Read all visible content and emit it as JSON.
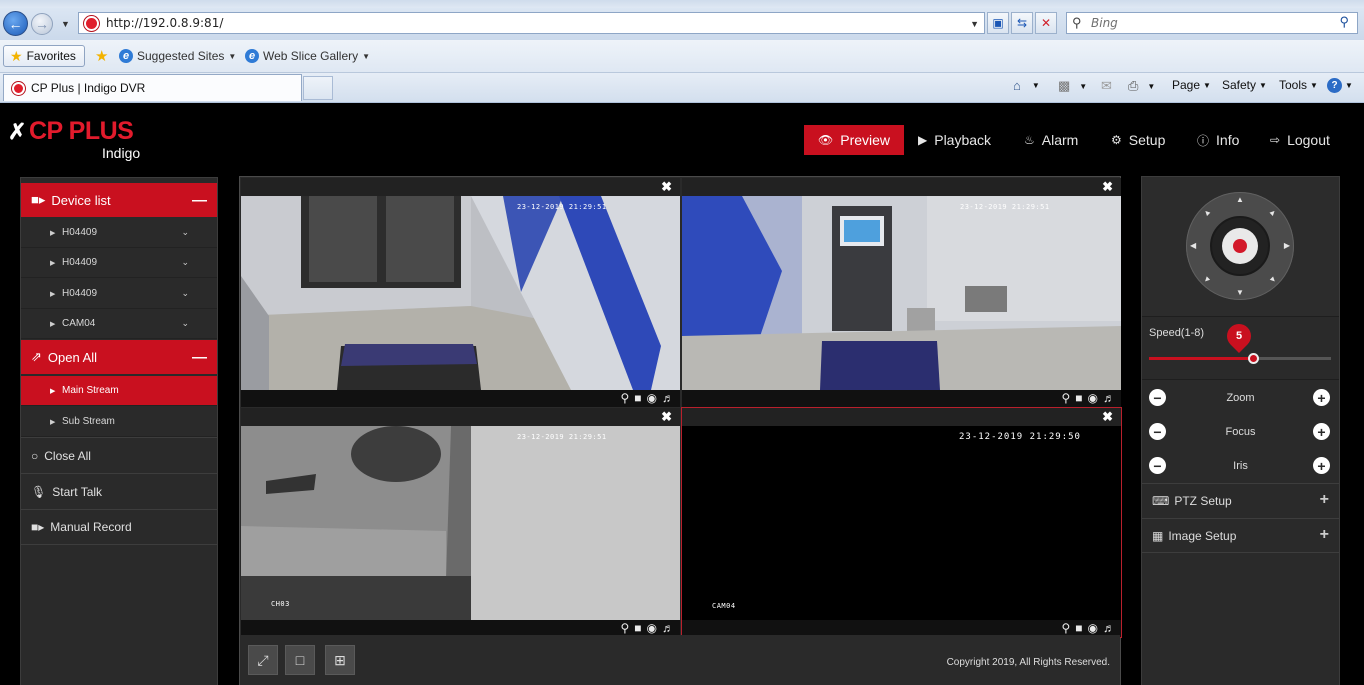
{
  "browser": {
    "url": "http://192.0.8.9:81/",
    "search_placeholder": "Bing",
    "favorites_label": "Favorites",
    "fav_links": [
      "Suggested Sites",
      "Web Slice Gallery"
    ],
    "tab_title": "CP Plus | Indigo DVR",
    "command_items": [
      "Page",
      "Safety",
      "Tools"
    ]
  },
  "app": {
    "brand": "CP PLUS",
    "brand_sub": "Indigo",
    "nav": [
      {
        "label": "Preview",
        "icon": "eye-icon",
        "active": true
      },
      {
        "label": "Playback",
        "icon": "play-icon"
      },
      {
        "label": "Alarm",
        "icon": "bell-icon"
      },
      {
        "label": "Setup",
        "icon": "gear-icon"
      },
      {
        "label": "Info",
        "icon": "info-icon"
      },
      {
        "label": "Logout",
        "icon": "logout-icon"
      }
    ],
    "accent_color": "#c9101f"
  },
  "sidebar": {
    "device_list_label": "Device list",
    "devices": [
      "H04409",
      "H04409",
      "H04409",
      "CAM04"
    ],
    "open_all_label": "Open All",
    "streams": [
      {
        "label": "Main Stream",
        "selected": true
      },
      {
        "label": "Sub Stream",
        "selected": false
      }
    ],
    "close_all_label": "Close All",
    "start_talk_label": "Start Talk",
    "manual_record_label": "Manual Record"
  },
  "grid": {
    "cells": [
      {
        "osd": "23-12-2019 21:29:51"
      },
      {
        "osd": "23-12-2019 21:29:51"
      },
      {
        "osd": "23-12-2019 21:29:51",
        "bottom_osd": "CH03"
      },
      {
        "osd": "23-12-2019 21:29:50",
        "bottom_osd": "CAM04"
      }
    ],
    "copyright": "Copyright 2019, All Rights Reserved."
  },
  "ptz": {
    "speed_label": "Speed(1-8)",
    "speed_value": "5",
    "speed_fraction": 0.57,
    "zoom_label": "Zoom",
    "focus_label": "Focus",
    "iris_label": "Iris",
    "ptz_setup_label": "PTZ Setup",
    "image_setup_label": "Image Setup"
  }
}
